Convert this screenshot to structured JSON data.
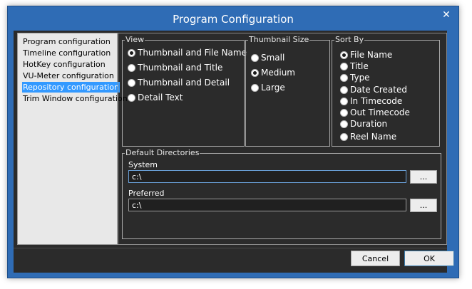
{
  "window": {
    "title": "Program Configuration",
    "close_glyph": "✕"
  },
  "sidebar": {
    "items": [
      {
        "label": "Program configuration"
      },
      {
        "label": "Timeline configuration"
      },
      {
        "label": "HotKey configuration"
      },
      {
        "label": "VU-Meter configuration"
      },
      {
        "label": "Repository configuration",
        "selected": true
      },
      {
        "label": "Trim Window configuration"
      }
    ]
  },
  "view": {
    "legend": "View",
    "options": [
      {
        "label": "Thumbnail and File Name",
        "checked": true
      },
      {
        "label": "Thumbnail and Title",
        "checked": false
      },
      {
        "label": "Thumbnail and Detail",
        "checked": false
      },
      {
        "label": "Detail Text",
        "checked": false
      }
    ]
  },
  "thumbnail_size": {
    "legend": "Thumbnail Size",
    "options": [
      {
        "label": "Small",
        "checked": false
      },
      {
        "label": "Medium",
        "checked": true
      },
      {
        "label": "Large",
        "checked": false
      }
    ]
  },
  "sort_by": {
    "legend": "Sort By",
    "options": [
      {
        "label": "File Name",
        "checked": true
      },
      {
        "label": "Title",
        "checked": false
      },
      {
        "label": "Type",
        "checked": false
      },
      {
        "label": "Date Created",
        "checked": false
      },
      {
        "label": "In Timecode",
        "checked": false
      },
      {
        "label": "Out Timecode",
        "checked": false
      },
      {
        "label": "Duration",
        "checked": false
      },
      {
        "label": "Reel Name",
        "checked": false
      }
    ]
  },
  "directories": {
    "legend": "Default Directories",
    "system": {
      "label": "System",
      "value": "c:\\",
      "browse_label": "..."
    },
    "preferred": {
      "label": "Preferred",
      "value": "c:\\",
      "browse_label": "..."
    }
  },
  "footer": {
    "cancel_label": "Cancel",
    "ok_label": "OK"
  },
  "colors": {
    "title_bar": "#2f6cb5",
    "client_bg": "#2b2b2b",
    "selection": "#3399ff"
  }
}
